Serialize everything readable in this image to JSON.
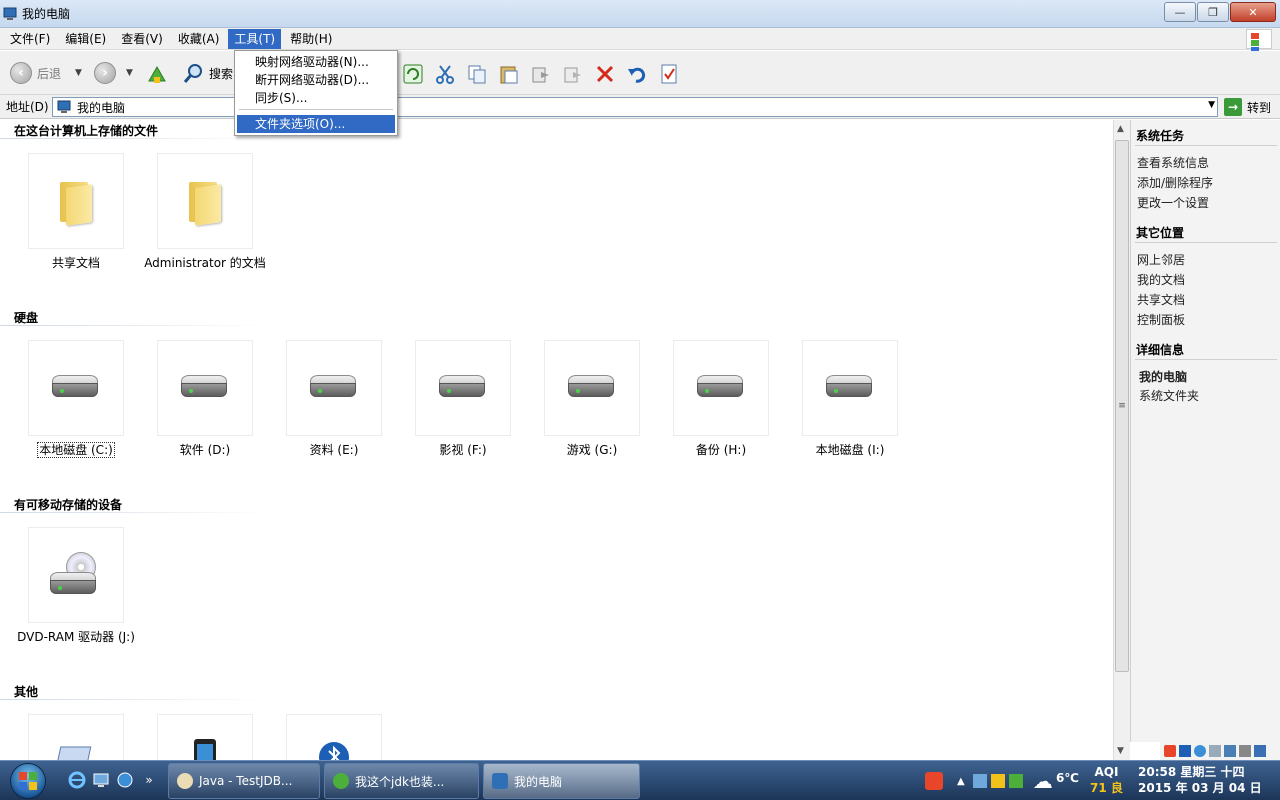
{
  "window": {
    "title": "我的电脑",
    "minimize": "—",
    "maximize": "❐",
    "close": "✕"
  },
  "menubar": [
    "文件(F)",
    "编辑(E)",
    "查看(V)",
    "收藏(A)",
    "工具(T)",
    "帮助(H)"
  ],
  "toolbar": {
    "back_label": "后退",
    "search_label": "搜索"
  },
  "tools_menu": {
    "items": [
      "映射网络驱动器(N)...",
      "断开网络驱动器(D)...",
      "同步(S)...",
      "文件夹选项(O)..."
    ],
    "highlighted": "文件夹选项(O)..."
  },
  "address": {
    "label": "地址(D)",
    "value": "我的电脑",
    "go_label": "转到"
  },
  "sections": {
    "files": {
      "title": "在这台计算机上存储的文件",
      "items": [
        "共享文档",
        "Administrator 的文档"
      ]
    },
    "drives": {
      "title": "硬盘",
      "items": [
        "本地磁盘 (C:)",
        "软件 (D:)",
        "资料 (E:)",
        "影视 (F:)",
        "游戏 (G:)",
        "备份 (H:)",
        "本地磁盘 (I:)"
      ]
    },
    "removable": {
      "title": "有可移动存储的设备",
      "items": [
        "DVD-RAM 驱动器 (J:)"
      ]
    },
    "other": {
      "title": "其他"
    }
  },
  "sidebar": {
    "system_tasks": {
      "title": "系统任务",
      "items": [
        "查看系统信息",
        "添加/删除程序",
        "更改一个设置"
      ]
    },
    "other_places": {
      "title": "其它位置",
      "items": [
        "网上邻居",
        "我的文档",
        "共享文档",
        "控制面板"
      ]
    },
    "details": {
      "title": "详细信息",
      "name": "我的电脑",
      "type": "系统文件夹"
    }
  },
  "taskbar": {
    "overflow": "»",
    "tasks": [
      "Java - TestJDB...",
      "我这个jdk也装...",
      "我的电脑"
    ],
    "temperature": "6℃",
    "aqi_label": "AQI",
    "aqi_value": "71 良",
    "time": "20:58 星期三 十四",
    "date": "2015 年 03 月 04 日"
  },
  "colors": {
    "menu_highlight": "#316ac5",
    "taskbar": "#1c3558"
  }
}
